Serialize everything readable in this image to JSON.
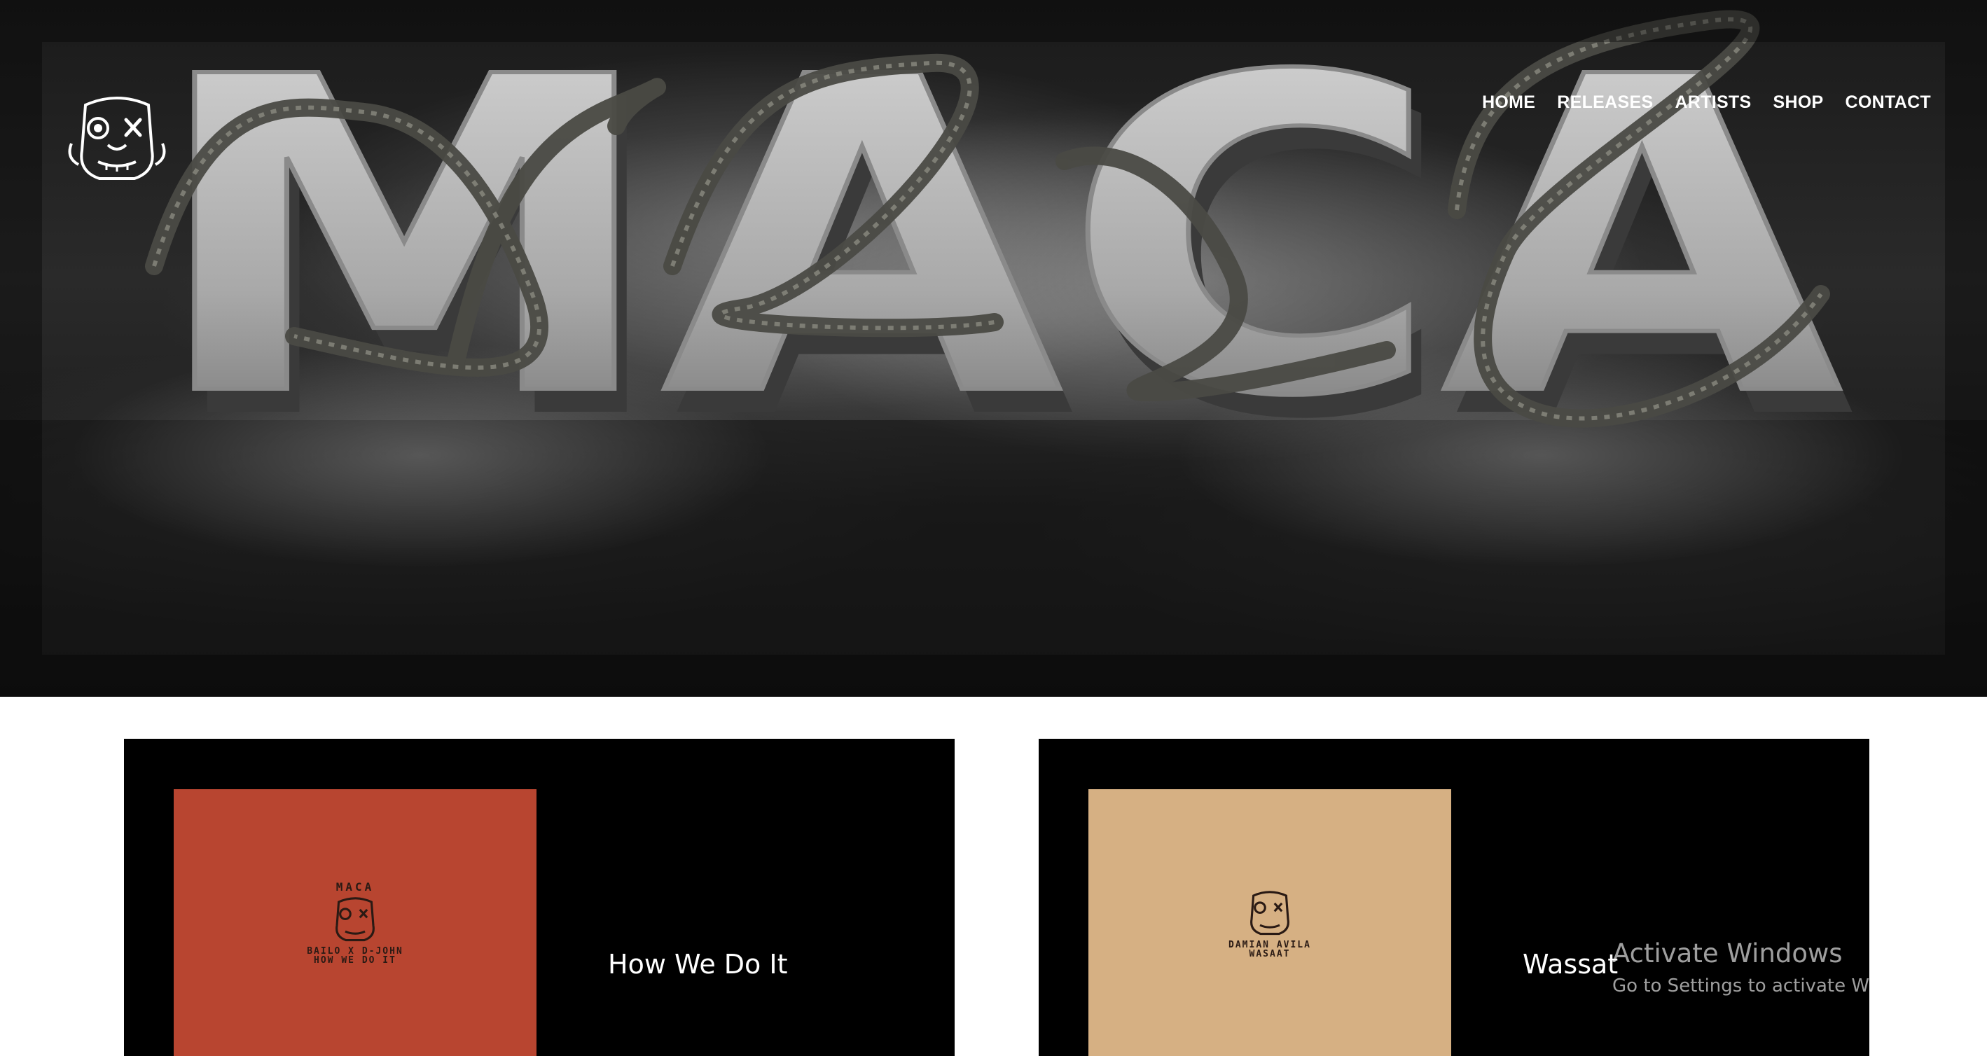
{
  "hero": {
    "headline": "MACA"
  },
  "nav": {
    "items": [
      "HOME",
      "RELEASES",
      "ARTISTS",
      "SHOP",
      "CONTACT"
    ]
  },
  "releases": [
    {
      "title": "How We Do It",
      "cover_label": "MACA",
      "cover_artists": "BAILO X D-JOHN",
      "cover_track": "HOW WE DO IT",
      "cover_color": "#b84530"
    },
    {
      "title": "Wassat",
      "cover_artists": "DAMIAN AVILA",
      "cover_track": "WASAAT",
      "cover_color": "#d6b083"
    }
  ],
  "watermark": {
    "title": "Activate Windows",
    "subtitle": "Go to Settings to activate Windows."
  }
}
